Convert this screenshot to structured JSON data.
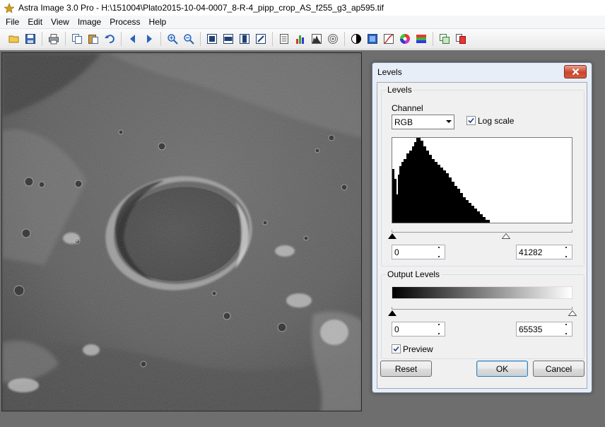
{
  "window": {
    "title": "Astra Image 3.0 Pro - H:\\151004\\Plato2015-10-04-0007_8-R-4_pipp_crop_AS_f255_g3_ap595.tif"
  },
  "menu": [
    "File",
    "Edit",
    "View",
    "Image",
    "Process",
    "Help"
  ],
  "toolbar": {
    "groups": [
      [
        "open-folder-icon",
        "save-icon"
      ],
      [
        "print-icon"
      ],
      [
        "copy-icon",
        "paste-icon",
        "undo-icon"
      ],
      [
        "previous-icon",
        "next-icon"
      ],
      [
        "zoom-in-icon",
        "zoom-out-icon"
      ],
      [
        "fit-image-icon",
        "fit-width-icon",
        "fit-height-icon",
        "actual-size-icon"
      ],
      [
        "properties-icon",
        "histogram-icon",
        "levels-icon",
        "target-icon"
      ],
      [
        "contrast-icon",
        "color-balance-icon",
        "curves-icon",
        "color-wheel-icon",
        "rgb-channels-icon"
      ],
      [
        "duplicate-icon",
        "compare-icon"
      ]
    ]
  },
  "dialog": {
    "title": "Levels",
    "levels_group": {
      "label": "Levels",
      "channel_label": "Channel",
      "channel_value": "RGB",
      "log_scale_label": "Log scale",
      "log_scale_checked": true,
      "black_point": "0",
      "white_point": "41282",
      "histogram_max_fraction": 0.55
    },
    "output_group": {
      "label": "Output Levels",
      "black_point": "0",
      "white_point": "65535"
    },
    "preview_label": "Preview",
    "preview_checked": true,
    "buttons": {
      "reset": "Reset",
      "ok": "OK",
      "cancel": "Cancel"
    }
  },
  "colors": {
    "workspace_bg": "#6e6e6e",
    "dialog_frame": "#e8eef7",
    "close_button": "#c9452c"
  }
}
